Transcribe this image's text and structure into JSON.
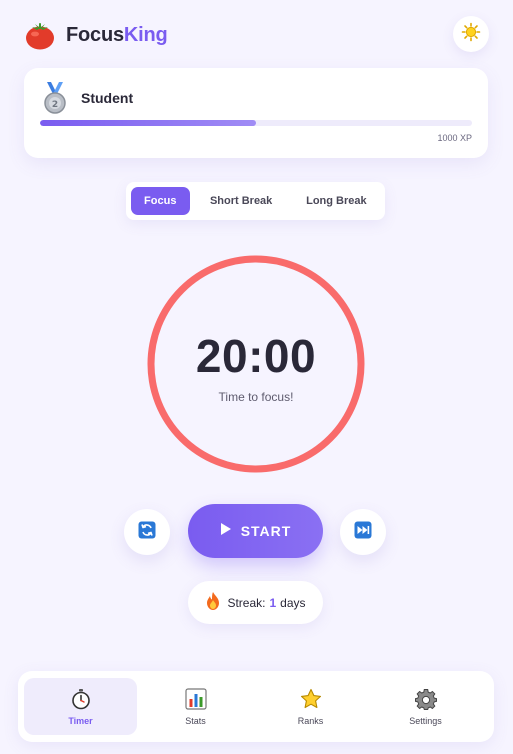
{
  "app": {
    "title_part1": "Focus",
    "title_part2": "King"
  },
  "header": {
    "logo_icon": "tomato-icon",
    "theme_icon": "sun-icon"
  },
  "rank": {
    "name": "Student",
    "medal_icon": "medal-icon",
    "xp_progress": 0.5,
    "xp_label": "1000 XP"
  },
  "modes": {
    "tabs": [
      "Focus",
      "Short Break",
      "Long Break"
    ],
    "active": 0
  },
  "timer": {
    "time": "20:00",
    "subtitle": "Time to focus!",
    "progress": 1.0,
    "ring_color": "#f96b6b"
  },
  "controls": {
    "reset_icon": "refresh-icon",
    "start_label": "START",
    "start_icon": "play-icon",
    "skip_icon": "skip-forward-icon"
  },
  "streak": {
    "label": "Streak:",
    "value": "1",
    "unit": "days",
    "icon": "fire-icon"
  },
  "nav": {
    "items": [
      {
        "label": "Timer",
        "icon": "stopwatch-icon",
        "active": true
      },
      {
        "label": "Stats",
        "icon": "bar-chart-icon",
        "active": false
      },
      {
        "label": "Ranks",
        "icon": "star-icon",
        "active": false
      },
      {
        "label": "Settings",
        "icon": "gear-icon",
        "active": false
      }
    ]
  },
  "colors": {
    "accent": "#7a5cf0",
    "timer_ring": "#f96b6b",
    "background": "#f6f4ff"
  }
}
